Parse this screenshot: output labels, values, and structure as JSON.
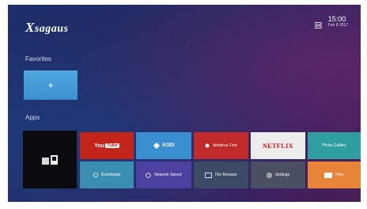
{
  "header": {
    "logo_initial": "X",
    "logo_rest": "sagaus",
    "time": "15:00",
    "date": "Feb 8 2017",
    "network_icon": "ethernet-icon"
  },
  "favorites": {
    "title": "Favorites",
    "add_symbol": "+"
  },
  "apps": {
    "title": "Apps",
    "tiles": [
      {
        "name": "YouTube",
        "label_left": "You",
        "label_right": "Tube",
        "color": "#c4251b"
      },
      {
        "name": "Kodi",
        "label": "KODI",
        "color": "#3a8fd0"
      },
      {
        "name": "Antivirus",
        "label": "Antivirus Free",
        "color": "#c12a2a"
      },
      {
        "name": "Netflix",
        "label": "NETFLIX",
        "color": "#ececec"
      },
      {
        "name": "Photo Gallery",
        "label": "Photo Gallery",
        "color": "#2f9ea0"
      },
      {
        "name": "Downloads",
        "label": "Downloads",
        "color": "#3a8fb0"
      },
      {
        "name": "Network Speed",
        "label": "Network Speed",
        "color": "#4b3fa0"
      },
      {
        "name": "File Browser",
        "label": "File Browser",
        "color": "#3c4a66"
      },
      {
        "name": "Settings",
        "label": "Settings",
        "color": "#4a4f63"
      },
      {
        "name": "Files",
        "label": "Files",
        "color": "#e8843a"
      }
    ]
  }
}
